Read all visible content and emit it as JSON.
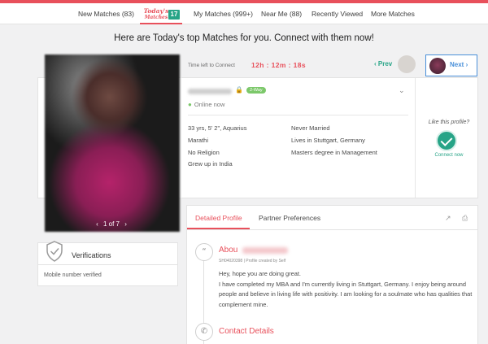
{
  "nav": {
    "items": [
      "New Matches (83)",
      "My Matches (999+)",
      "Near Me (88)",
      "Recently Viewed",
      "More Matches"
    ],
    "todays_line1": "Today's",
    "todays_line2": "Matches",
    "todays_count": "17"
  },
  "headline": "Here are Today's top Matches for you. Connect with them now!",
  "photo": {
    "pager": "1 of 7",
    "prev_arrow": "‹",
    "next_arrow": "›"
  },
  "timer": {
    "label": "Time left to Connect",
    "value": "12h : 12m : 18s"
  },
  "pagination": {
    "prev": "‹ Prev",
    "next": "Next ›"
  },
  "profile": {
    "badge": "2-Way",
    "online": "Online now",
    "left_attrs": [
      "33 yrs, 5' 2\", Aquarius",
      "Marathi",
      "No Religion",
      "Grew up in India"
    ],
    "right_attrs": [
      "Never Married",
      "Lives in Stuttgart, Germany",
      "Masters degree in Management"
    ]
  },
  "like": {
    "question": "Like this profile?",
    "connect": "Connect now"
  },
  "tabs": {
    "detailed": "Detailed Profile",
    "partner": "Partner Preferences"
  },
  "about": {
    "title": "Abou",
    "meta": "SH04020398  |  Profile created by Self",
    "lines": [
      "Hey, hope you are doing great.",
      "I have completed my MBA and I'm currently living in Stuttgart, Germany. I enjoy being around people and believe in living life with positivity. I am looking for a soulmate who has qualities that complement mine."
    ]
  },
  "contact": {
    "title": "Contact Details"
  },
  "verifications": {
    "title": "Verifications",
    "item": "Mobile number verified"
  },
  "colors": {
    "accent": "#e8505b",
    "green": "#27a487",
    "blue": "#4a90d9"
  }
}
